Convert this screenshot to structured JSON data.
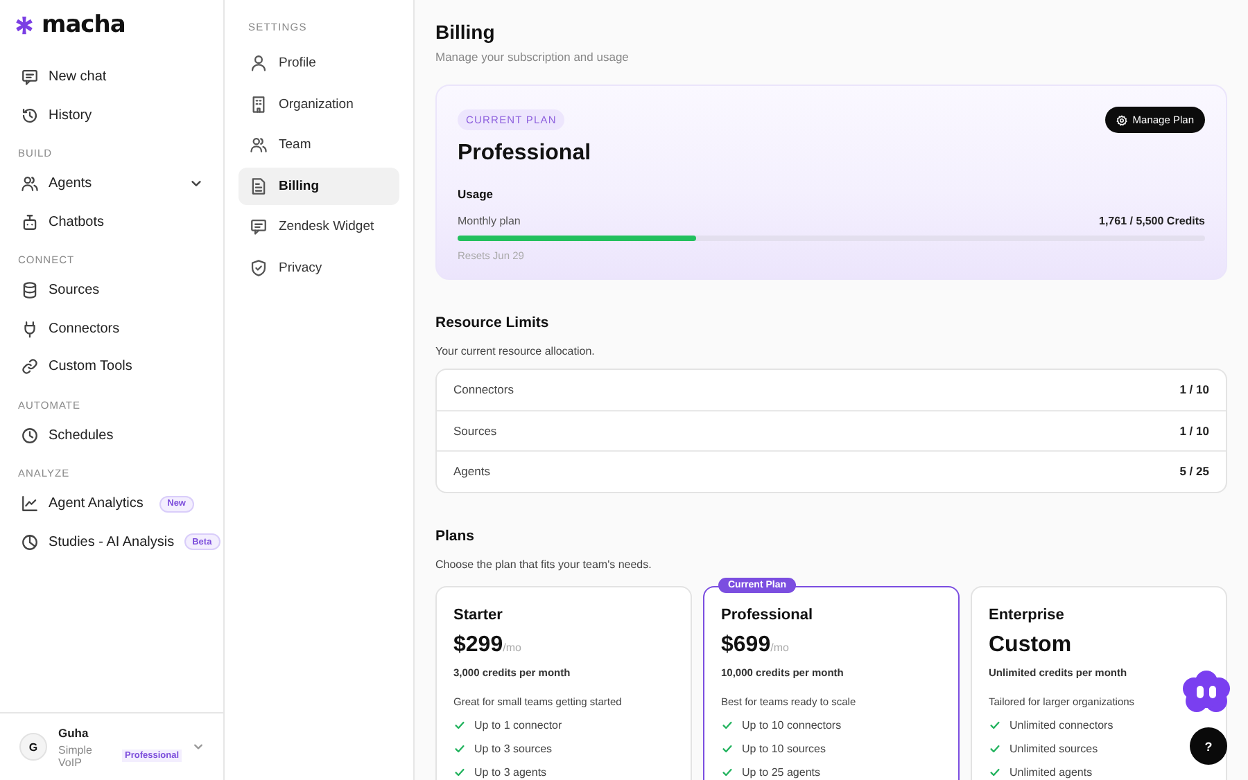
{
  "brand": {
    "name": "macha"
  },
  "sidebar": {
    "items": [
      {
        "kind": "item",
        "label": "New chat",
        "selected": false
      },
      {
        "kind": "item",
        "label": "History",
        "selected": false
      },
      {
        "kind": "section",
        "label": "BUILD"
      },
      {
        "kind": "item",
        "label": "Agents",
        "selected": false,
        "expanded": false
      },
      {
        "kind": "item",
        "label": "Chatbots",
        "selected": false
      },
      {
        "kind": "section",
        "label": "CONNECT"
      },
      {
        "kind": "item",
        "label": "Sources",
        "selected": false
      },
      {
        "kind": "item",
        "label": "Connectors",
        "selected": false
      },
      {
        "kind": "item",
        "label": "Custom Tools",
        "selected": false
      },
      {
        "kind": "section",
        "label": "AUTOMATE"
      },
      {
        "kind": "item",
        "label": "Schedules",
        "selected": false
      },
      {
        "kind": "section",
        "label": "ANALYZE"
      },
      {
        "kind": "item",
        "label": "Agent Analytics",
        "selected": false,
        "badge": "New"
      },
      {
        "kind": "item",
        "label": "Studies - AI Analysis",
        "selected": false,
        "badge": "Beta"
      }
    ],
    "user": {
      "initial": "G",
      "name": "Guha",
      "org": "Simple VoIP",
      "plan": "Professional"
    }
  },
  "settings_nav": {
    "heading": "SETTINGS",
    "items": [
      {
        "label": "Profile",
        "selected": false
      },
      {
        "label": "Organization",
        "selected": false
      },
      {
        "label": "Team",
        "selected": false
      },
      {
        "label": "Billing",
        "selected": true
      },
      {
        "label": "Zendesk Widget",
        "selected": false
      },
      {
        "label": "Privacy",
        "selected": false
      }
    ]
  },
  "page": {
    "title": "Billing",
    "subtitle": "Manage your subscription and usage"
  },
  "current_plan": {
    "badge": "CURRENT PLAN",
    "name": "Professional",
    "button": "Manage Plan",
    "usage_title": "Usage",
    "usage_label": "Monthly plan",
    "usage_reading": "1,761 / 5,500 Credits",
    "level": 0.32,
    "resets": "Resets Jun 29"
  },
  "resource_limits": {
    "title": "Resource Limits",
    "subtitle": "Your current resource allocation.",
    "rows": [
      {
        "name": "Connectors",
        "value": "1 / 10"
      },
      {
        "name": "Sources",
        "value": "1 / 10"
      },
      {
        "name": "Agents",
        "value": "5 / 25"
      }
    ]
  },
  "plans": {
    "title": "Plans",
    "subtitle": "Choose the plan that fits your team's needs.",
    "items": [
      {
        "name": "Starter",
        "price": "$299",
        "period": "/mo",
        "credits": "3,000 credits per month",
        "description": "Great for small teams getting started",
        "current": false,
        "features": [
          "Up to 1 connector",
          "Up to 3 sources",
          "Up to 3 agents"
        ]
      },
      {
        "name": "Professional",
        "price": "$699",
        "period": "/mo",
        "credits": "10,000 credits per month",
        "description": "Best for teams ready to scale",
        "current": true,
        "current_badge": "Current Plan",
        "features": [
          "Up to 10 connectors",
          "Up to 10 sources",
          "Up to 25 agents"
        ]
      },
      {
        "name": "Enterprise",
        "price": "Custom",
        "credits": "Unlimited credits per month",
        "description": "Tailored for larger organizations",
        "current": false,
        "features": [
          "Unlimited connectors",
          "Unlimited sources",
          "Unlimited agents"
        ]
      }
    ]
  },
  "help_button": {
    "label": "?"
  }
}
